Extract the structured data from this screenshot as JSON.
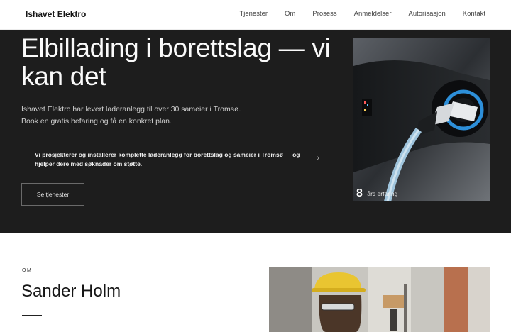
{
  "header": {
    "brand": "Ishavet Elektro",
    "nav": [
      "Tjenester",
      "Om",
      "Prosess",
      "Anmeldelser",
      "Autorisasjon",
      "Kontakt"
    ]
  },
  "hero": {
    "title": "Elbillading i borettslag — vi kan det",
    "intro_line1": "Ishavet Elektro har levert laderanlegg til over 30 sameier i Tromsø.",
    "intro_line2": "Book en gratis befaring og få en konkret plan.",
    "card_text": "Vi prosjekterer og installerer komplette laderanlegg for borettslag og sameier i Tromsø — og hjelper dere med søknader om støtte.",
    "button_label": "Se tjenester",
    "stat_number": "8",
    "stat_label": "års erfaring",
    "chevron_icon": "chevron-right-icon",
    "image_subject": "ev-charger-plug-icon"
  },
  "about": {
    "eyebrow": "OM",
    "name": "Sander Holm",
    "image_subject": "electrician-portrait-icon"
  },
  "colors": {
    "hero_bg": "#1d1d1d",
    "page_bg": "#ffffff",
    "text_dark": "#161616"
  }
}
